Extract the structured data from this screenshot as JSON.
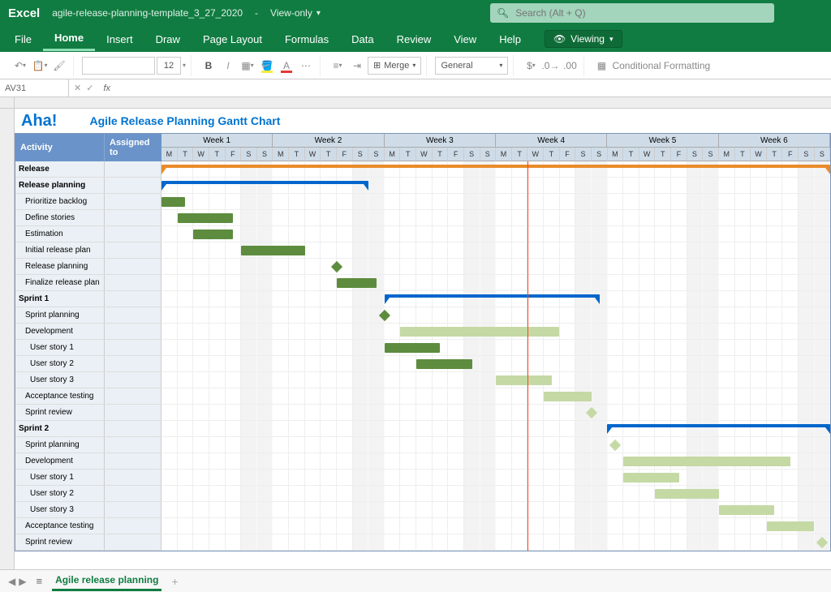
{
  "app": {
    "name": "Excel",
    "doc": "agile-release-planning-template_3_27_2020",
    "mode": "View-only"
  },
  "search": {
    "placeholder": "Search (Alt + Q)"
  },
  "menu": {
    "items": [
      "File",
      "Home",
      "Insert",
      "Draw",
      "Page Layout",
      "Formulas",
      "Data",
      "Review",
      "View",
      "Help"
    ],
    "active": "Home",
    "viewing": "Viewing"
  },
  "ribbon": {
    "fontsize": "12",
    "merge": "Merge",
    "format": "General",
    "cond": "Conditional Formatting"
  },
  "formulabar": {
    "cell": "AV31"
  },
  "chart": {
    "logo": "Aha!",
    "title": "Agile Release Planning Gantt Chart"
  },
  "headers": {
    "activity": "Activity",
    "assigned": "Assigned to"
  },
  "weeks": [
    "Week 1",
    "Week 2",
    "Week 3",
    "Week 4",
    "Week 5",
    "Week 6"
  ],
  "days": [
    "M",
    "T",
    "W",
    "T",
    "F",
    "S",
    "S"
  ],
  "rows": [
    {
      "label": "Release",
      "bold": true,
      "indent": 0
    },
    {
      "label": "Release planning",
      "bold": true,
      "indent": 0
    },
    {
      "label": "Prioritize backlog",
      "bold": false,
      "indent": 1
    },
    {
      "label": "Define stories",
      "bold": false,
      "indent": 1
    },
    {
      "label": "Estimation",
      "bold": false,
      "indent": 1
    },
    {
      "label": "Initial release plan",
      "bold": false,
      "indent": 1
    },
    {
      "label": "Release planning",
      "bold": false,
      "indent": 1
    },
    {
      "label": "Finalize release plan",
      "bold": false,
      "indent": 1
    },
    {
      "label": "Sprint 1",
      "bold": true,
      "indent": 0
    },
    {
      "label": "Sprint planning",
      "bold": false,
      "indent": 1
    },
    {
      "label": "Development",
      "bold": false,
      "indent": 1
    },
    {
      "label": "User story 1",
      "bold": false,
      "indent": 2
    },
    {
      "label": "User story 2",
      "bold": false,
      "indent": 2
    },
    {
      "label": "User story 3",
      "bold": false,
      "indent": 2
    },
    {
      "label": "Acceptance testing",
      "bold": false,
      "indent": 1
    },
    {
      "label": "Sprint review",
      "bold": false,
      "indent": 1
    },
    {
      "label": "Sprint 2",
      "bold": true,
      "indent": 0
    },
    {
      "label": "Sprint planning",
      "bold": false,
      "indent": 1
    },
    {
      "label": "Development",
      "bold": false,
      "indent": 1
    },
    {
      "label": "User story 1",
      "bold": false,
      "indent": 2
    },
    {
      "label": "User story 2",
      "bold": false,
      "indent": 2
    },
    {
      "label": "User story 3",
      "bold": false,
      "indent": 2
    },
    {
      "label": "Acceptance testing",
      "bold": false,
      "indent": 1
    },
    {
      "label": "Sprint review",
      "bold": false,
      "indent": 1
    }
  ],
  "sheets": {
    "active": "Agile release planning"
  },
  "chart_data": {
    "type": "gantt",
    "title": "Agile Release Planning Gantt Chart",
    "timescale": {
      "unit": "day",
      "start": 0,
      "end": 42,
      "weeks": 6
    },
    "today": 23,
    "tasks": [
      {
        "row": 0,
        "name": "Release",
        "type": "summary-orange",
        "start": 0,
        "end": 42
      },
      {
        "row": 1,
        "name": "Release planning",
        "type": "summary",
        "start": 0,
        "end": 13
      },
      {
        "row": 2,
        "name": "Prioritize backlog",
        "type": "bar",
        "start": 0,
        "end": 1.5
      },
      {
        "row": 3,
        "name": "Define stories",
        "type": "bar",
        "start": 1,
        "end": 4.5
      },
      {
        "row": 4,
        "name": "Estimation",
        "type": "bar",
        "start": 2,
        "end": 4.5
      },
      {
        "row": 5,
        "name": "Initial release plan",
        "type": "bar",
        "start": 5,
        "end": 9
      },
      {
        "row": 6,
        "name": "Release planning",
        "type": "milestone",
        "at": 11
      },
      {
        "row": 7,
        "name": "Finalize release plan",
        "type": "bar",
        "start": 11,
        "end": 13.5
      },
      {
        "row": 8,
        "name": "Sprint 1",
        "type": "summary",
        "start": 14,
        "end": 27.5
      },
      {
        "row": 9,
        "name": "Sprint planning",
        "type": "milestone",
        "at": 14
      },
      {
        "row": 10,
        "name": "Development",
        "type": "bar-light",
        "start": 15,
        "end": 25
      },
      {
        "row": 11,
        "name": "User story 1",
        "type": "bar",
        "start": 14,
        "end": 17.5
      },
      {
        "row": 12,
        "name": "User story 2",
        "type": "bar",
        "start": 16,
        "end": 19.5
      },
      {
        "row": 13,
        "name": "User story 3",
        "type": "bar-light",
        "start": 21,
        "end": 24.5
      },
      {
        "row": 14,
        "name": "Acceptance testing",
        "type": "bar-light",
        "start": 24,
        "end": 27
      },
      {
        "row": 15,
        "name": "Sprint review",
        "type": "milestone-light",
        "at": 27
      },
      {
        "row": 16,
        "name": "Sprint 2",
        "type": "summary",
        "start": 28,
        "end": 42
      },
      {
        "row": 17,
        "name": "Sprint planning",
        "type": "milestone-light",
        "at": 28.5
      },
      {
        "row": 18,
        "name": "Development",
        "type": "bar-light",
        "start": 29,
        "end": 39.5
      },
      {
        "row": 19,
        "name": "User story 1",
        "type": "bar-light",
        "start": 29,
        "end": 32.5
      },
      {
        "row": 20,
        "name": "User story 2",
        "type": "bar-light",
        "start": 31,
        "end": 35
      },
      {
        "row": 21,
        "name": "User story 3",
        "type": "bar-light",
        "start": 35,
        "end": 38.5
      },
      {
        "row": 22,
        "name": "Acceptance testing",
        "type": "bar-light",
        "start": 38,
        "end": 41
      },
      {
        "row": 23,
        "name": "Sprint review",
        "type": "milestone-light",
        "at": 41.5
      }
    ]
  }
}
